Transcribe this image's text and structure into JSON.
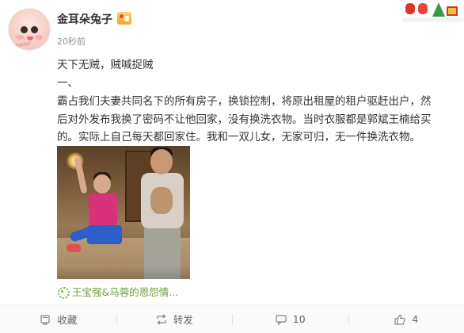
{
  "post": {
    "author": "金耳朵兔子",
    "timestamp": "20秒前",
    "lines": [
      "天下无贼，贼喊捉贼",
      "一、",
      "霸占我们夫妻共同名下的所有房子，换锁控制，将原出租屋的租户驱赶出户，然",
      "后对外发布我换了密码不让他回家，没有换洗衣物。当时衣服都是郭斌王楠给买",
      "的。实际上自己每天都回家住。我和一双儿女，无家可归，无一件换洗衣物。"
    ],
    "topic": "王宝强&马蓉的恩怨情...",
    "avatar_signature": "Rabbit"
  },
  "footer": {
    "favorite_label": "收藏",
    "repost_label": "转发",
    "comment_count": "10",
    "like_count": "4"
  },
  "colors": {
    "topic_green": "#6a9d36",
    "text": "#333333",
    "muted": "#939393"
  },
  "icons": [
    "vip-badge-icon",
    "festive-decoration-icon",
    "topic-icon",
    "favorite-icon",
    "repost-icon",
    "comment-icon",
    "like-icon"
  ]
}
